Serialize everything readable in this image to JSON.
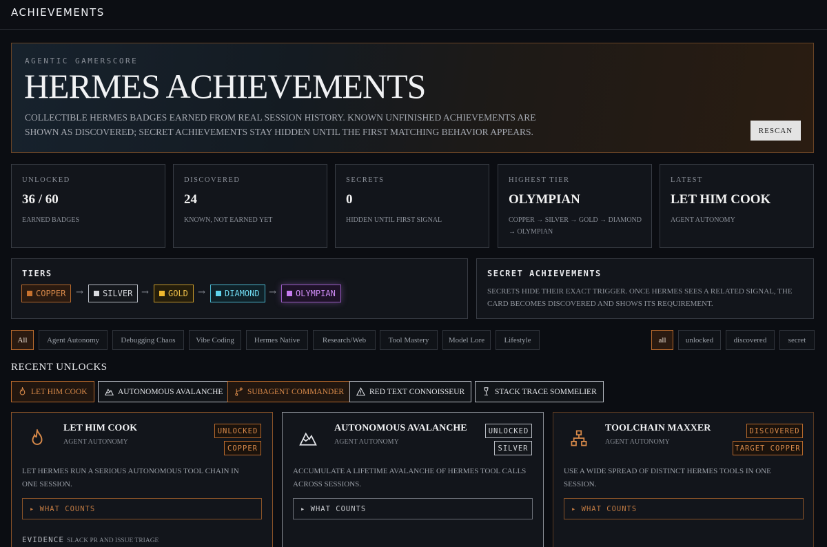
{
  "app": {
    "title": "ACHIEVEMENTS"
  },
  "hero": {
    "kicker": "AGENTIC GAMERSCORE",
    "title": "HERMES ACHIEVEMENTS",
    "description": "Collectible Hermes badges earned from real session history. Known unfinished achievements are shown as discovered; secret achievements stay hidden until the first matching behavior appears.",
    "rescan_label": "RESCAN"
  },
  "stats": [
    {
      "label": "UNLOCKED",
      "value": "36 / 60",
      "sub": "EARNED BADGES"
    },
    {
      "label": "DISCOVERED",
      "value": "24",
      "sub": "KNOWN, NOT EARNED YET"
    },
    {
      "label": "SECRETS",
      "value": "0",
      "sub": "HIDDEN UNTIL FIRST SIGNAL"
    },
    {
      "label": "HIGHEST TIER",
      "value": "OLYMPIAN",
      "sub": "COPPER → SILVER → GOLD → DIAMOND → OLYMPIAN"
    },
    {
      "label": "LATEST",
      "value": "LET HIM COOK",
      "sub": "AGENT AUTONOMY"
    }
  ],
  "tiers": {
    "heading": "TIERS",
    "items": [
      {
        "label": "COPPER",
        "color": "#c8722e"
      },
      {
        "label": "SILVER",
        "color": "#d9dbe0"
      },
      {
        "label": "GOLD",
        "color": "#f0b82e"
      },
      {
        "label": "DIAMOND",
        "color": "#5fd3ec"
      },
      {
        "label": "OLYMPIAN",
        "color": "#c77cf0"
      }
    ],
    "arrow": "→"
  },
  "secret_panel": {
    "heading": "SECRET ACHIEVEMENTS",
    "text": "SECRETS HIDE THEIR EXACT TRIGGER. ONCE HERMES SEES A RELATED SIGNAL, THE CARD BECOMES DISCOVERED AND SHOWS ITS REQUIREMENT."
  },
  "category_filters": [
    "All",
    "Agent Autonomy",
    "Debugging Chaos",
    "Vibe Coding",
    "Hermes Native",
    "Research/Web",
    "Tool Mastery",
    "Model Lore",
    "Lifestyle"
  ],
  "status_filters": [
    "all",
    "unlocked",
    "discovered",
    "secret"
  ],
  "recent": {
    "heading": "RECENT UNLOCKS",
    "items": [
      {
        "label": "LET HIM COOK",
        "icon": "flame-icon",
        "tier": "copper"
      },
      {
        "label": "AUTONOMOUS AVALANCHE",
        "icon": "mountain-icon",
        "tier": "silver"
      },
      {
        "label": "SUBAGENT COMMANDER",
        "icon": "branch-icon",
        "tier": "copper"
      },
      {
        "label": "RED TEXT CONNOISSEUR",
        "icon": "warning-icon",
        "tier": "silver"
      },
      {
        "label": "STACK TRACE SOMMELIER",
        "icon": "wine-glass-icon",
        "tier": "silver"
      }
    ]
  },
  "cards": [
    {
      "title": "LET HIM COOK",
      "category": "AGENT AUTONOMY",
      "status": "UNLOCKED",
      "tier": "COPPER",
      "icon": "flame-icon",
      "description": "Let Hermes run a serious autonomous tool chain in one session.",
      "what_counts": "▸ WHAT COUNTS",
      "evidence_label": "EVIDENCE",
      "evidence_value": "SLACK PR AND ISSUE TRIAGE"
    },
    {
      "title": "AUTONOMOUS AVALANCHE",
      "category": "AGENT AUTONOMY",
      "status": "UNLOCKED",
      "tier": "SILVER",
      "icon": "mountain-icon",
      "description": "Accumulate a lifetime avalanche of Hermes tool calls across sessions.",
      "what_counts": "▸ WHAT COUNTS"
    },
    {
      "title": "TOOLCHAIN MAXXER",
      "category": "AGENT AUTONOMY",
      "status": "DISCOVERED",
      "tier": "TARGET COPPER",
      "icon": "network-icon",
      "description": "Use a wide spread of distinct Hermes tools in one session.",
      "what_counts": "▸ WHAT COUNTS"
    }
  ]
}
